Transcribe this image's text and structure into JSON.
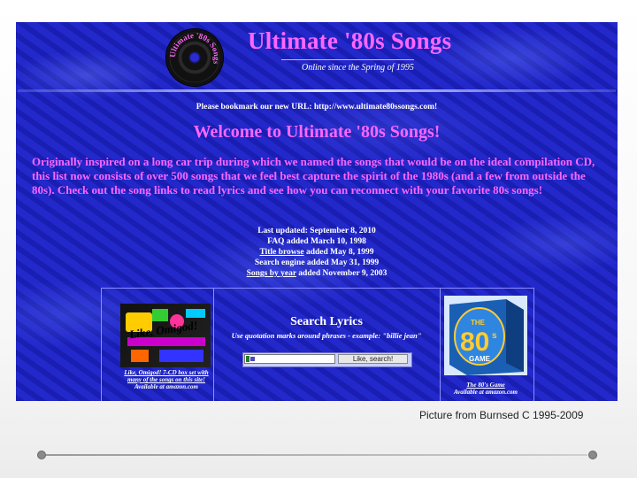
{
  "site": {
    "logo_text": "Ultimate '80s Songs",
    "title": "Ultimate '80s Songs",
    "tagline": "Online since the Spring of 1995"
  },
  "bookmark_notice": "Please bookmark our new URL: http://www.ultimate80ssongs.com!",
  "welcome_heading": "Welcome to Ultimate '80s Songs!",
  "intro_text": "Originally inspired on a long car trip during which we named the songs that would be on the ideal compilation CD, this list now consists of over 500 songs that we feel best capture the spirit of the 1980s (and a few from outside the 80s). Check out the song links to read lyrics and see how you can reconnect with your favorite 80s songs!",
  "updates": {
    "last_updated": "Last updated: September 8, 2010",
    "faq": "FAQ added March 10, 1998",
    "title_browse_link": "Title browse",
    "title_browse_text": " added May 8, 1999",
    "search_engine": "Search engine added May 31, 1999",
    "songs_by_year_link": "Songs by year",
    "songs_by_year_text": " added November 9, 2003"
  },
  "promo_left": {
    "image_text": "Like, Omigod!",
    "caption_line1": "Like, Omigod! 7-CD box set with",
    "caption_line2": "many of the songs on this site!",
    "caption_line3": "Available at amazon.com"
  },
  "search": {
    "title": "Search Lyrics",
    "hint": "Use quotation marks around phrases - example: \"billie jean\"",
    "input_value": "",
    "button_label": "Like, search!"
  },
  "promo_right": {
    "box_label_the": "THE",
    "box_label_80": "80",
    "box_label_s": "s",
    "box_label_game": "GAME",
    "caption_line1": "The 80's Game",
    "caption_line2": "Available at amazon.com"
  },
  "credit": "Picture from Burnsed C 1995-2009",
  "colors": {
    "page_bg": "#1f24c8",
    "heading_pink": "#ff66ff",
    "text_white": "#ffffff"
  }
}
